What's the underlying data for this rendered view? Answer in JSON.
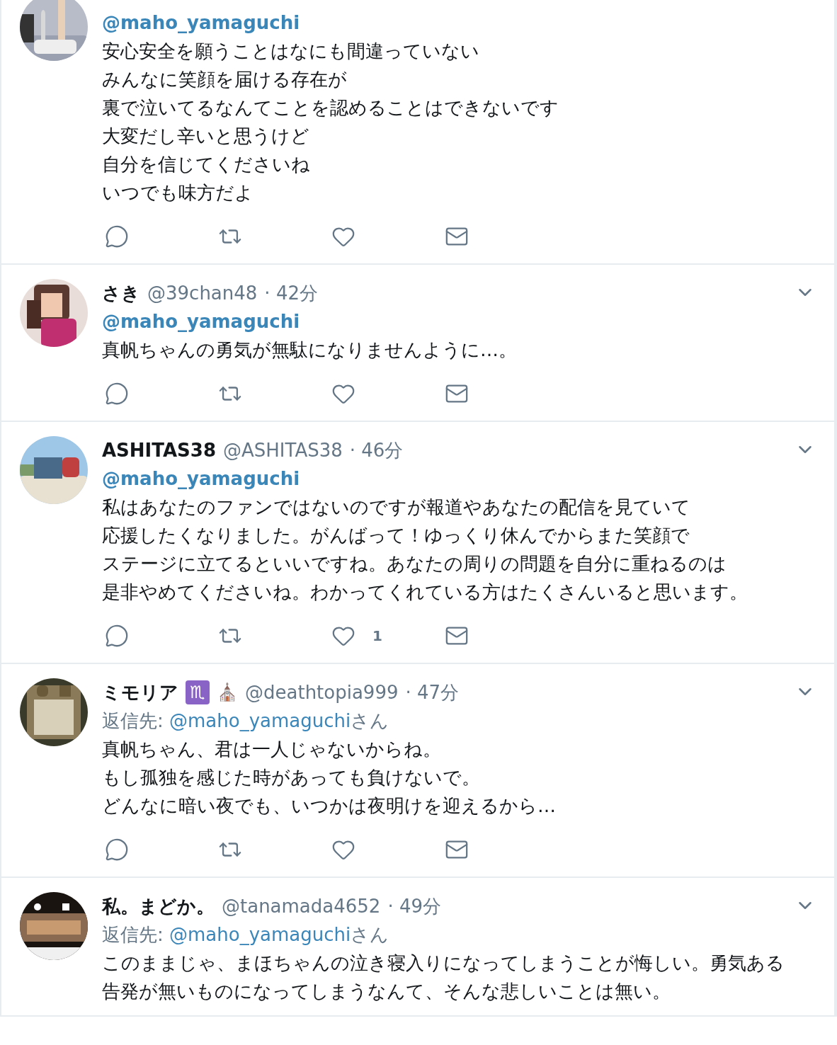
{
  "tweets": [
    {
      "avatar": {
        "kind": "picture"
      },
      "mention": "@maho_yamaguchi",
      "lines": [
        "安心安全を願うことはなにも間違っていない",
        "みんなに笑顔を届ける存在が",
        "裏で泣いてるなんてことを認めることはできないです",
        "大変だし辛いと思うけど",
        "自分を信じてくださいね",
        "いつでも味方だよ"
      ],
      "actions": [
        {
          "kind": "reply"
        },
        {
          "kind": "retweet"
        },
        {
          "kind": "like"
        },
        {
          "kind": "mail"
        }
      ]
    },
    {
      "avatar": {
        "kind": "picture"
      },
      "name": "さき",
      "handle": "@39chan48",
      "time": "· 42分",
      "mention": "@maho_yamaguchi",
      "lines": [
        "真帆ちゃんの勇気が無駄になりませんように…。"
      ],
      "actions": [
        {
          "kind": "reply"
        },
        {
          "kind": "retweet"
        },
        {
          "kind": "like"
        },
        {
          "kind": "mail"
        }
      ]
    },
    {
      "avatar": {
        "kind": "picture"
      },
      "name": "ASHITAS38",
      "handle": "@ASHITAS38",
      "time": "· 46分",
      "mention": "@maho_yamaguchi",
      "lines": [
        "私はあなたのファンではないのですが報道やあなたの配信を見ていて",
        "応援したくなりました。がんばって！ゆっくり休んでからまた笑顔で",
        "ステージに立てるといいですね。あなたの周りの問題を自分に重ねるのは",
        "是非やめてくださいね。わかってくれている方はたくさんいると思います。"
      ],
      "actions": [
        {
          "kind": "reply"
        },
        {
          "kind": "retweet"
        },
        {
          "kind": "like",
          "count": "1"
        },
        {
          "kind": "mail"
        }
      ]
    },
    {
      "avatar": {
        "kind": "picture"
      },
      "name": "ミモリア",
      "badges": [
        {
          "kind": "zodiac",
          "text": "♏"
        },
        {
          "kind": "church",
          "text": "⛪"
        }
      ],
      "handle": "@deathtopia999",
      "time": "· 47分",
      "reply": {
        "prefix": "返信先:",
        "handle": "@maho_yamaguchi",
        "suffix": "さん"
      },
      "lines": [
        "真帆ちゃん、君は一人じゃないからね。",
        "もし孤独を感じた時があっても負けないで。",
        "どんなに暗い夜でも、いつかは夜明けを迎えるから…"
      ],
      "actions": [
        {
          "kind": "reply"
        },
        {
          "kind": "retweet"
        },
        {
          "kind": "like"
        },
        {
          "kind": "mail"
        }
      ]
    },
    {
      "avatar": {
        "kind": "picture"
      },
      "name": "私。まどか。",
      "handle": "@tanamada4652",
      "time": "· 49分",
      "reply": {
        "prefix": "返信先:",
        "handle": "@maho_yamaguchi",
        "suffix": "さん"
      },
      "lines": [
        "このままじゃ、まほちゃんの泣き寝入りになってしまうことが悔しい。勇気ある",
        "告発が無いものになってしまうなんて、そんな悲しいことは無い。"
      ]
    }
  ]
}
